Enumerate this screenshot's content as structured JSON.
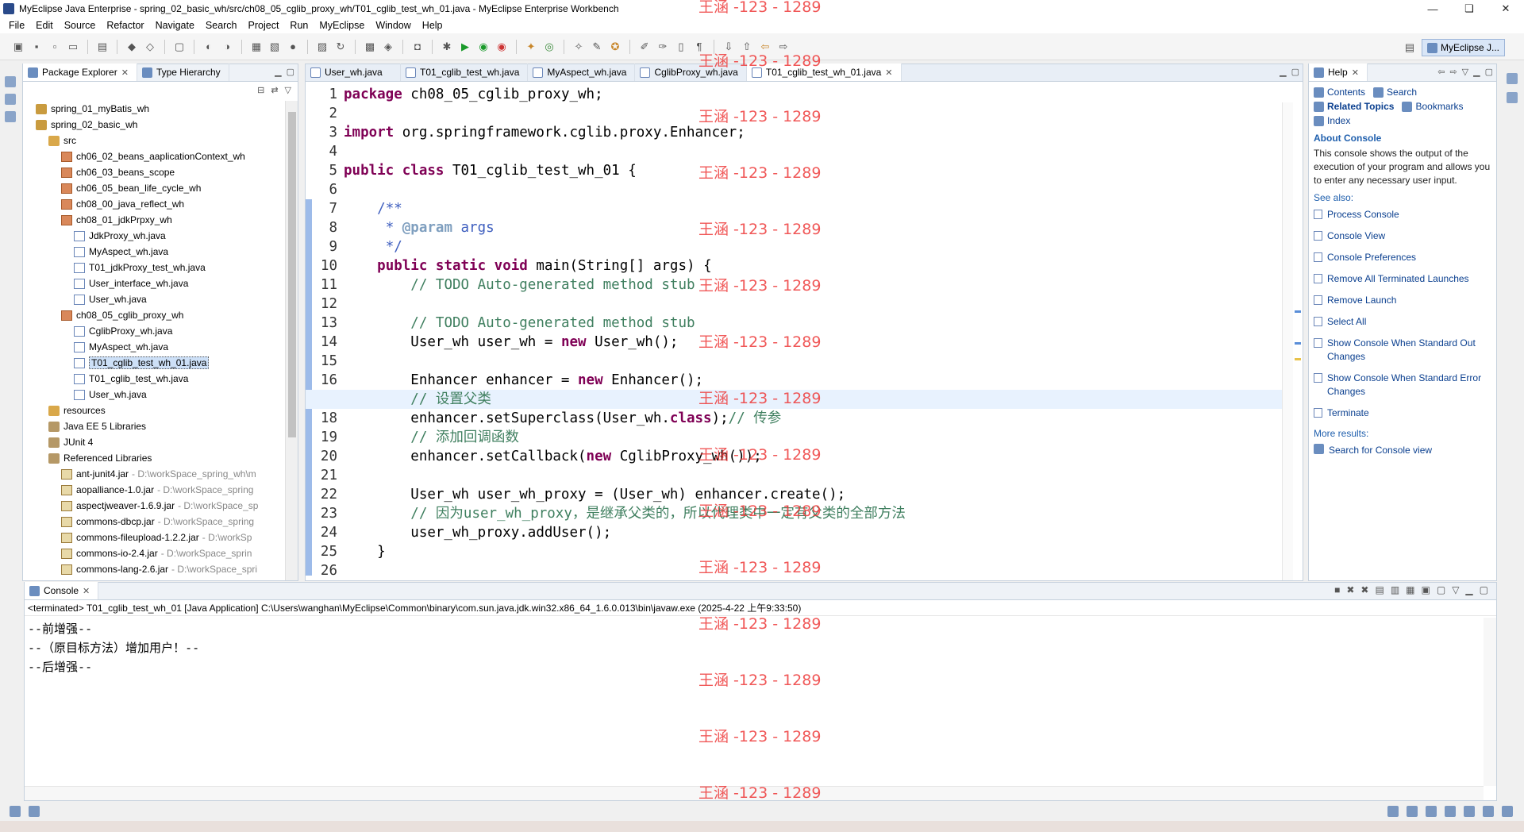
{
  "window": {
    "title": "MyEclipse Java Enterprise - spring_02_basic_wh/src/ch08_05_cglib_proxy_wh/T01_cglib_test_wh_01.java - MyEclipse Enterprise Workbench",
    "controls": [
      "—",
      "❏",
      "✕"
    ]
  },
  "menu": [
    "File",
    "Edit",
    "Source",
    "Refactor",
    "Navigate",
    "Search",
    "Project",
    "Run",
    "MyEclipse",
    "Window",
    "Help"
  ],
  "perspective": {
    "label": "MyEclipse J..."
  },
  "package_explorer": {
    "tabs": [
      "Package Explorer",
      "Type Hierarchy"
    ],
    "tree": [
      {
        "label": "spring_01_myBatis_wh",
        "indent": 0,
        "icon": "project-icon"
      },
      {
        "label": "spring_02_basic_wh",
        "indent": 0,
        "icon": "project-icon"
      },
      {
        "label": "src",
        "indent": 1,
        "icon": "folder-icon"
      },
      {
        "label": "ch06_02_beans_aaplicationContext_wh",
        "indent": 2,
        "icon": "package-icon"
      },
      {
        "label": "ch06_03_beans_scope",
        "indent": 2,
        "icon": "package-icon"
      },
      {
        "label": "ch06_05_bean_life_cycle_wh",
        "indent": 2,
        "icon": "package-icon"
      },
      {
        "label": "ch08_00_java_reflect_wh",
        "indent": 2,
        "icon": "package-icon"
      },
      {
        "label": "ch08_01_jdkPrpxy_wh",
        "indent": 2,
        "icon": "package-icon"
      },
      {
        "label": "JdkProxy_wh.java",
        "indent": 3,
        "icon": "java-file-icon"
      },
      {
        "label": "MyAspect_wh.java",
        "indent": 3,
        "icon": "java-file-icon"
      },
      {
        "label": "T01_jdkProxy_test_wh.java",
        "indent": 3,
        "icon": "java-file-icon"
      },
      {
        "label": "User_interface_wh.java",
        "indent": 3,
        "icon": "java-file-icon"
      },
      {
        "label": "User_wh.java",
        "indent": 3,
        "icon": "java-file-icon"
      },
      {
        "label": "ch08_05_cglib_proxy_wh",
        "indent": 2,
        "icon": "package-icon"
      },
      {
        "label": "CglibProxy_wh.java",
        "indent": 3,
        "icon": "java-file-icon"
      },
      {
        "label": "MyAspect_wh.java",
        "indent": 3,
        "icon": "java-file-icon"
      },
      {
        "label": "T01_cglib_test_wh_01.java",
        "indent": 3,
        "icon": "java-file-icon",
        "selected": true
      },
      {
        "label": "T01_cglib_test_wh.java",
        "indent": 3,
        "icon": "java-file-icon"
      },
      {
        "label": "User_wh.java",
        "indent": 3,
        "icon": "java-file-icon"
      },
      {
        "label": "resources",
        "indent": 1,
        "icon": "folder-icon"
      },
      {
        "label": "Java EE 5 Libraries",
        "indent": 1,
        "icon": "library-icon"
      },
      {
        "label": "JUnit 4",
        "indent": 1,
        "icon": "library-icon"
      },
      {
        "label": "Referenced Libraries",
        "indent": 1,
        "icon": "library-icon"
      },
      {
        "label": "ant-junit4.jar",
        "indent": 2,
        "icon": "jar-icon",
        "path": "- D:\\workSpace_spring_wh\\m"
      },
      {
        "label": "aopalliance-1.0.jar",
        "indent": 2,
        "icon": "jar-icon",
        "path": "- D:\\workSpace_spring"
      },
      {
        "label": "aspectjweaver-1.6.9.jar",
        "indent": 2,
        "icon": "jar-icon",
        "path": "- D:\\workSpace_sp"
      },
      {
        "label": "commons-dbcp.jar",
        "indent": 2,
        "icon": "jar-icon",
        "path": "- D:\\workSpace_spring"
      },
      {
        "label": "commons-fileupload-1.2.2.jar",
        "indent": 2,
        "icon": "jar-icon",
        "path": "- D:\\workSp"
      },
      {
        "label": "commons-io-2.4.jar",
        "indent": 2,
        "icon": "jar-icon",
        "path": "- D:\\workSpace_sprin"
      },
      {
        "label": "commons-lang-2.6.jar",
        "indent": 2,
        "icon": "jar-icon",
        "path": "- D:\\workSpace_spri"
      }
    ]
  },
  "editor": {
    "tabs": [
      {
        "label": "User_wh.java",
        "active": false
      },
      {
        "label": "T01_cglib_test_wh.java",
        "active": false
      },
      {
        "label": "MyAspect_wh.java",
        "active": false
      },
      {
        "label": "CglibProxy_wh.java",
        "active": false
      },
      {
        "label": "T01_cglib_test_wh_01.java",
        "active": true
      }
    ],
    "highlight_line": 17,
    "lines": [
      [
        [
          "kw",
          "package"
        ],
        [
          "t",
          " ch08_05_cglib_proxy_wh;"
        ]
      ],
      [],
      [
        [
          "kw",
          "import"
        ],
        [
          "t",
          " org.springframework.cglib.proxy.Enhancer;"
        ]
      ],
      [],
      [
        [
          "kw",
          "public class"
        ],
        [
          "t",
          " T01_cglib_test_wh_01 {"
        ]
      ],
      [],
      [
        [
          "t",
          "    "
        ],
        [
          "jd",
          "/**"
        ]
      ],
      [
        [
          "t",
          "     "
        ],
        [
          "jd",
          "* "
        ],
        [
          "tag",
          "@param"
        ],
        [
          "jd",
          " args"
        ]
      ],
      [
        [
          "t",
          "     "
        ],
        [
          "jd",
          "*/"
        ]
      ],
      [
        [
          "t",
          "    "
        ],
        [
          "kw",
          "public static void"
        ],
        [
          "t",
          " main(String[] args) {"
        ]
      ],
      [
        [
          "t",
          "        "
        ],
        [
          "cm",
          "// TODO Auto-generated method stub"
        ]
      ],
      [],
      [
        [
          "t",
          "        "
        ],
        [
          "cm",
          "// TODO Auto-generated method stub"
        ]
      ],
      [
        [
          "t",
          "        User_wh user_wh = "
        ],
        [
          "kw",
          "new"
        ],
        [
          "t",
          " User_wh();"
        ]
      ],
      [],
      [
        [
          "t",
          "        Enhancer enhancer = "
        ],
        [
          "kw",
          "new"
        ],
        [
          "t",
          " Enhancer();"
        ]
      ],
      [
        [
          "t",
          "        "
        ],
        [
          "cm",
          "// 设置父类"
        ]
      ],
      [
        [
          "t",
          "        enhancer.setSuperclass(User_wh."
        ],
        [
          "kw",
          "class"
        ],
        [
          "t",
          ");"
        ],
        [
          "cm",
          "// 传参"
        ]
      ],
      [
        [
          "t",
          "        "
        ],
        [
          "cm",
          "// 添加回调函数"
        ]
      ],
      [
        [
          "t",
          "        enhancer.setCallback("
        ],
        [
          "kw",
          "new"
        ],
        [
          "t",
          " CglibProxy_wh());"
        ]
      ],
      [],
      [
        [
          "t",
          "        User_wh user_wh_proxy = (User_wh) enhancer.create();"
        ]
      ],
      [
        [
          "t",
          "        "
        ],
        [
          "cm",
          "// 因为user_wh_proxy，是继承父类的，所以代理类中一定有父类的全部方法"
        ]
      ],
      [
        [
          "t",
          "        user_wh_proxy.addUser();"
        ]
      ],
      [
        [
          "t",
          "    }"
        ]
      ],
      []
    ]
  },
  "help": {
    "tab": "Help",
    "links": [
      {
        "label": "Contents",
        "bold": false,
        "icon": "contents-icon"
      },
      {
        "label": "Search",
        "bold": false,
        "icon": "search-icon"
      },
      {
        "label": "Related Topics",
        "bold": true,
        "icon": "related-topics-icon"
      },
      {
        "label": "Bookmarks",
        "bold": false,
        "icon": "bookmarks-icon"
      },
      {
        "label": "Index",
        "bold": false,
        "icon": "index-icon"
      }
    ],
    "about_title": "About Console",
    "about_text": "This console shows the output of the execution of your program and allows you to enter any necessary user input.",
    "see_also": "See also:",
    "see_items": [
      "Process Console",
      "Console View",
      "Console Preferences",
      "Remove All Terminated Launches",
      "Remove Launch",
      "Select All",
      "Show Console When Standard Out Changes",
      "Show Console When Standard Error Changes",
      "Terminate"
    ],
    "more_results": "More results:",
    "search_for": "Search for Console view"
  },
  "console": {
    "tab": "Console",
    "status": "<terminated> T01_cglib_test_wh_01 [Java Application] C:\\Users\\wanghan\\MyEclipse\\Common\\binary\\com.sun.java.jdk.win32.x86_64_1.6.0.013\\bin\\javaw.exe (2025-4-22 上午9:33:50)",
    "output": [
      "--前增强--",
      "--（原目标方法）增加用户！--",
      "--后增强--"
    ]
  },
  "watermark": "王涵 -123 - 1289",
  "colors": {
    "keyword": "#7f0055",
    "comment": "#3f7f5f",
    "javadoc": "#3f5fbf",
    "watermark": "#ee3a3a",
    "selection": "#cde0f7"
  }
}
